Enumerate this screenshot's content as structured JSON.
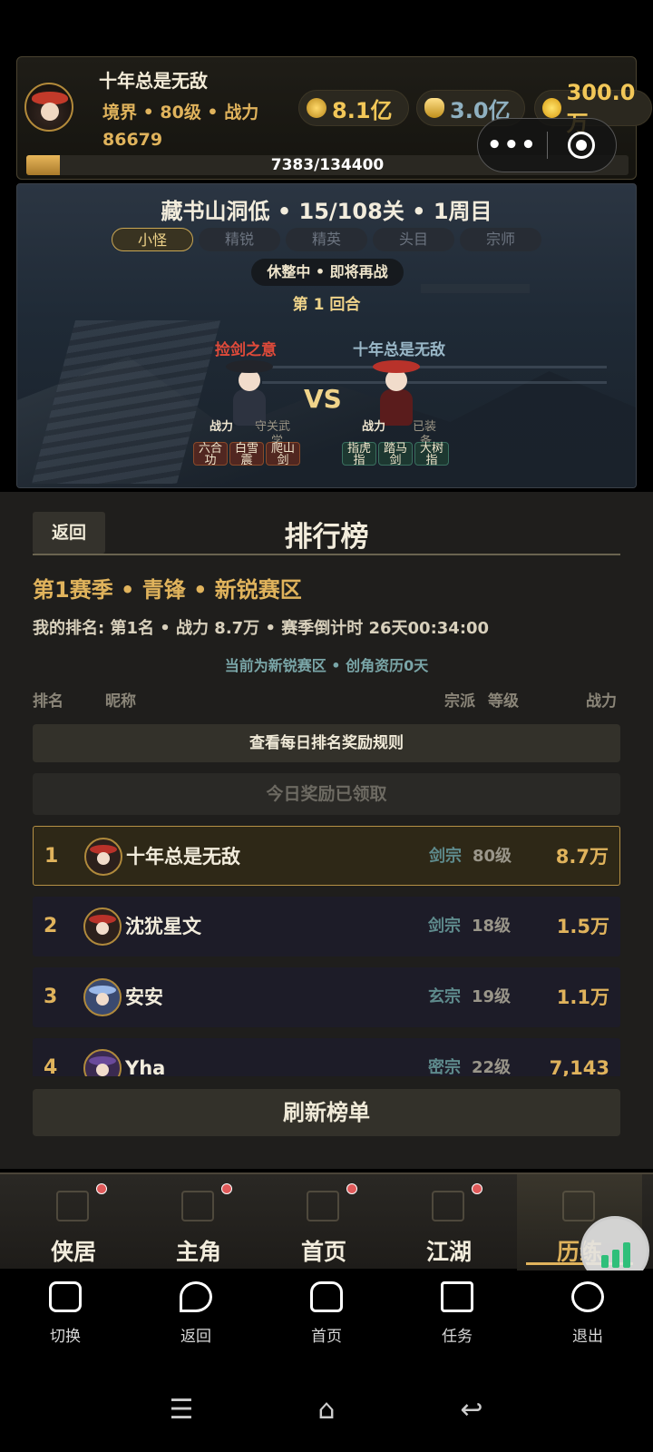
{
  "header": {
    "player_name": "十年总是无敌",
    "realm_line": "境界 • 80级 • 战力",
    "power_value": "86679",
    "resources": [
      {
        "icon": "coin-icon",
        "value": "8.1亿"
      },
      {
        "icon": "gold-ingot-icon",
        "value": "3.0亿"
      },
      {
        "icon": "gold-gourd-icon",
        "value": "300.0万"
      }
    ],
    "exp_text": "7383/134400",
    "exp_progress": 0.055,
    "capsule": {
      "more": "•••",
      "close": "target-icon"
    }
  },
  "battle": {
    "stage_title": "藏书山洞低 • 15/108关 • 1周目",
    "tabs": [
      "小怪",
      "精锐",
      "精英",
      "头目",
      "宗师"
    ],
    "active_tab": 0,
    "status": "休整中 • 即将再战",
    "round": "第 1 回合",
    "vs": "VS",
    "left": {
      "name": "捡剑之意",
      "power_label": "战力",
      "extra": "守关武",
      "extra2": "学",
      "skills": [
        "六合 功",
        "白雪 震",
        "爬山 剑"
      ]
    },
    "right": {
      "name": "十年总是无敌",
      "power_label": "战力",
      "extra": "已装",
      "extra2": "备",
      "skills": [
        "指虎 指",
        "踏马 剑",
        "大树 指"
      ]
    }
  },
  "ranking": {
    "back_label": "返回",
    "title": "排行榜",
    "season": "第1赛季 • 青锋 • 新锐赛区",
    "my_rank": "我的排名: 第1名 • 战力 8.7万 • 赛季倒计时 26天00:34:00",
    "zone_note": "当前为新锐赛区 • 创角资历0天",
    "columns": {
      "rank": "排名",
      "nickname": "昵称",
      "sect": "宗派",
      "level": "等级",
      "power": "战力"
    },
    "rule_button": "查看每日排名奖励规则",
    "claimed_button": "今日奖励已领取",
    "rows": [
      {
        "rank": "1",
        "name": "十年总是无敌",
        "sect": "剑宗",
        "level": "80级",
        "power": "8.7万"
      },
      {
        "rank": "2",
        "name": "沈犹星文",
        "sect": "剑宗",
        "level": "18级",
        "power": "1.5万"
      },
      {
        "rank": "3",
        "name": "安安",
        "sect": "玄宗",
        "level": "19级",
        "power": "1.1万"
      },
      {
        "rank": "4",
        "name": "Yha",
        "sect": "密宗",
        "level": "22级",
        "power": "7,143"
      }
    ],
    "refresh_button": "刷新榜单"
  },
  "game_nav": [
    {
      "label": "侠居",
      "icon": "house-icon",
      "badge": true
    },
    {
      "label": "主角",
      "icon": "hero-icon",
      "badge": true
    },
    {
      "label": "首页",
      "icon": "home-icon",
      "badge": true
    },
    {
      "label": "江湖",
      "icon": "mountain-icon",
      "badge": true
    },
    {
      "label": "历练",
      "icon": "swords-icon",
      "badge": false,
      "active": true
    }
  ],
  "mp_bar": [
    {
      "label": "切换",
      "icon": "switch-icon"
    },
    {
      "label": "返回",
      "icon": "back-arrow-icon"
    },
    {
      "label": "首页",
      "icon": "home-icon"
    },
    {
      "label": "任务",
      "icon": "task-icon"
    },
    {
      "label": "退出",
      "icon": "exit-icon"
    }
  ]
}
